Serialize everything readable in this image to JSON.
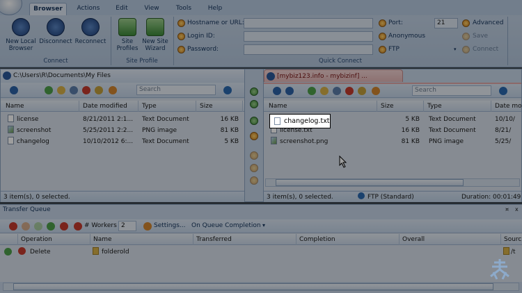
{
  "menu": {
    "tabs": [
      {
        "label": "Browser"
      },
      {
        "label": "Actions"
      },
      {
        "label": "Edit"
      },
      {
        "label": "View"
      },
      {
        "label": "Tools"
      },
      {
        "label": "Help"
      }
    ]
  },
  "ribbon": {
    "connect": {
      "buttons": [
        {
          "label": "New Local\nBrowser"
        },
        {
          "label": "Disconnect"
        },
        {
          "label": "Reconnect"
        }
      ],
      "group_label": "Connect"
    },
    "site_profile": {
      "buttons": [
        {
          "label": "Site\nProfiles"
        },
        {
          "label": "New Site\nWizard"
        }
      ],
      "group_label": "Site Profile"
    },
    "quick_connect": {
      "host_label": "Hostname or URL:",
      "login_label": "Login ID:",
      "password_label": "Password:",
      "port_label": "Port:",
      "port_value": "21",
      "anonymous_label": "Anonymous",
      "protocol_value": "FTP",
      "advanced_label": "Advanced",
      "save_label": "Save",
      "connect_label": "Connect",
      "group_label": "Quick Connect"
    }
  },
  "left_pane": {
    "path": "C:\\Users\\R\\Documents\\My Files",
    "search_placeholder": "Search",
    "columns": [
      "Name",
      "Date modified",
      "Type",
      "Size"
    ],
    "rows": [
      {
        "name": "license",
        "date": "8/21/2011 2:1...",
        "type": "Text Document",
        "size": "16 KB"
      },
      {
        "name": "screenshot",
        "date": "5/25/2011 2:2...",
        "type": "PNG image",
        "size": "81 KB"
      },
      {
        "name": "changelog",
        "date": "10/10/2012 6:...",
        "type": "Text Document",
        "size": "5 KB"
      }
    ],
    "status": "3 item(s), 0 selected."
  },
  "right_pane": {
    "tab_title": "[mybiz123.info - mybizinf] ...",
    "search_placeholder": "Search",
    "columns": [
      "Name",
      "Size",
      "Type",
      "Date mo"
    ],
    "rows": [
      {
        "name": "changelog.txt",
        "size": "5 KB",
        "type": "Text Document",
        "date": "10/10/"
      },
      {
        "name": "license.txt",
        "size": "16 KB",
        "type": "Text Document",
        "date": "8/21/"
      },
      {
        "name": "screenshot.png",
        "size": "81 KB",
        "type": "PNG image",
        "date": "5/25/"
      }
    ],
    "status": "3 item(s), 0 selected.",
    "protocol_status": "FTP (Standard)",
    "duration": "Duration: 00:01:49"
  },
  "queue": {
    "title": "Transfer Queue",
    "pin": "¤",
    "close": "x",
    "workers_label": "# Workers",
    "workers_value": "2",
    "settings_label": "Settings...",
    "completion_label": "On Queue Completion",
    "columns": [
      "Operation",
      "Name",
      "Transferred",
      "Completion",
      "Overall",
      "Sourc"
    ],
    "rows": [
      {
        "operation": "Delete",
        "name": "folderold",
        "source": "/t"
      }
    ]
  }
}
